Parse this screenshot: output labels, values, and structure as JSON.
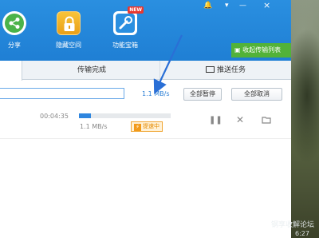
{
  "window_controls": {
    "bell": "bell-icon",
    "menu": "menu-icon",
    "minimize": "—",
    "close": "×"
  },
  "toolbar": {
    "items": [
      {
        "label": "分享",
        "icon": "share-icon"
      },
      {
        "label": "隐藏空间",
        "icon": "lock-icon"
      },
      {
        "label": "功能宝箱",
        "icon": "toolbox-icon",
        "badge": "NEW"
      }
    ],
    "collapse_label": "收起传输列表"
  },
  "tabs": {
    "done": "传输完成",
    "push": "推送任务"
  },
  "speedbar": {
    "total_speed": "1.1 MB/s",
    "pause_all": "全部暂停",
    "cancel_all": "全部取消"
  },
  "task": {
    "time_remaining": "00:04:35",
    "speed": "1.1 MB/s",
    "progress": 0.13,
    "boost_label": "提速中"
  },
  "watermark": {
    "line1": "钢享收解论坛",
    "line2": "6:27"
  },
  "colors": {
    "toolbar": "#1f7fd4",
    "accent": "#2b7fd6",
    "collapse": "#52b239",
    "boost": "#f29a1a",
    "arrow": "#2a6fd6"
  }
}
